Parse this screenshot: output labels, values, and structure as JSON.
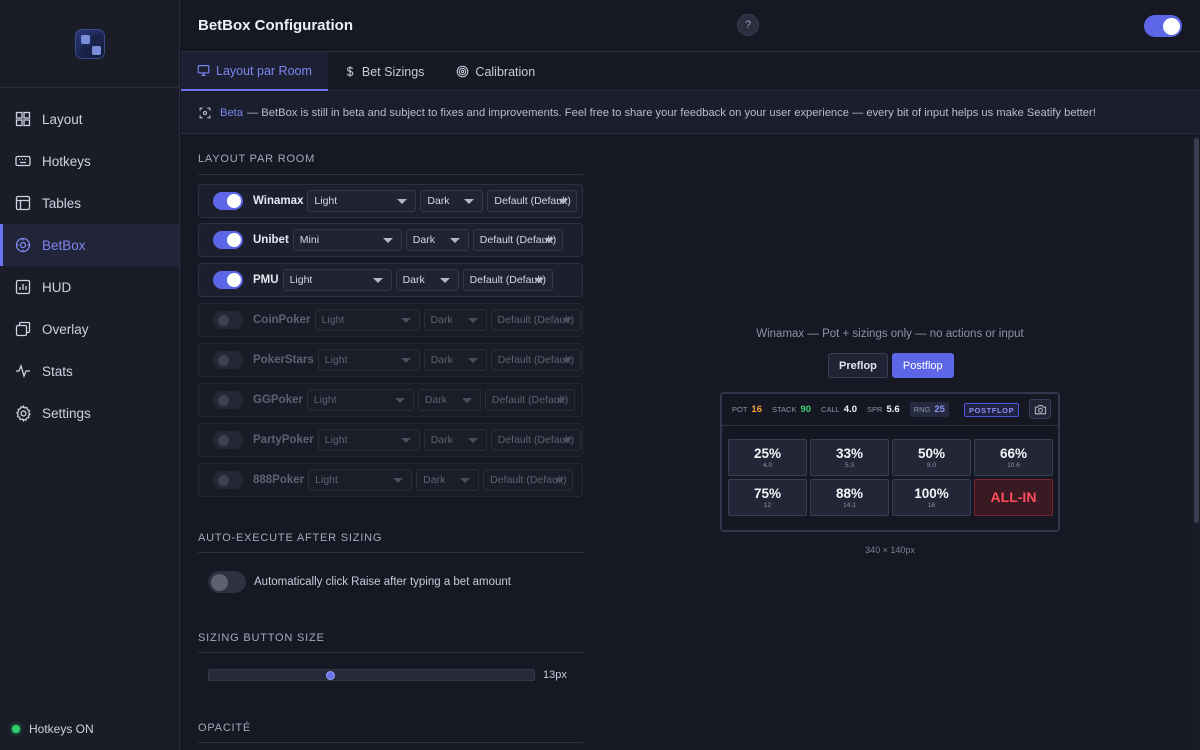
{
  "app": {
    "title": "BetBox Configuration",
    "help_label": "?",
    "master_enabled": true
  },
  "sidebar": {
    "items": [
      {
        "label": "Layout",
        "icon": "layout-grid-icon",
        "active": false
      },
      {
        "label": "Hotkeys",
        "icon": "keyboard-icon",
        "active": false
      },
      {
        "label": "Tables",
        "icon": "table-icon",
        "active": false
      },
      {
        "label": "BetBox",
        "icon": "chip-icon",
        "active": true
      },
      {
        "label": "HUD",
        "icon": "bar-chart-icon",
        "active": false
      },
      {
        "label": "Overlay",
        "icon": "overlay-icon",
        "active": false
      },
      {
        "label": "Stats",
        "icon": "activity-icon",
        "active": false
      },
      {
        "label": "Settings",
        "icon": "gear-icon",
        "active": false
      }
    ],
    "status": "Hotkeys ON"
  },
  "tabs": [
    {
      "label": "Layout par Room",
      "icon": "monitor-icon",
      "active": true
    },
    {
      "label": "Bet Sizings",
      "icon": "dollar-icon",
      "active": false
    },
    {
      "label": "Calibration",
      "icon": "target-icon",
      "active": false
    }
  ],
  "banner": {
    "beta": "Beta",
    "text": "— BetBox is still in beta and subject to fixes and improvements. Feel free to share your feedback on your user experience — every bit of input helps us make Seatify better!"
  },
  "layout_section": {
    "title": "LAYOUT PAR ROOM",
    "rooms": [
      {
        "name": "Winamax",
        "enabled": true,
        "size": "Light",
        "theme": "Dark",
        "preset": "Default (Default)"
      },
      {
        "name": "Unibet",
        "enabled": true,
        "size": "Mini",
        "theme": "Dark",
        "preset": "Default (Default)"
      },
      {
        "name": "PMU",
        "enabled": true,
        "size": "Light",
        "theme": "Dark",
        "preset": "Default (Default)"
      },
      {
        "name": "CoinPoker",
        "enabled": false,
        "size": "Light",
        "theme": "Dark",
        "preset": "Default (Default)"
      },
      {
        "name": "PokerStars",
        "enabled": false,
        "size": "Light",
        "theme": "Dark",
        "preset": "Default (Default)"
      },
      {
        "name": "GGPoker",
        "enabled": false,
        "size": "Light",
        "theme": "Dark",
        "preset": "Default (Default)"
      },
      {
        "name": "PartyPoker",
        "enabled": false,
        "size": "Light",
        "theme": "Dark",
        "preset": "Default (Default)"
      },
      {
        "name": "888Poker",
        "enabled": false,
        "size": "Light",
        "theme": "Dark",
        "preset": "Default (Default)"
      }
    ]
  },
  "auto_execute": {
    "title": "AUTO-EXECUTE AFTER SIZING",
    "label": "Automatically click Raise after typing a bet amount",
    "enabled": false
  },
  "sizing_button": {
    "title": "SIZING BUTTON SIZE",
    "value_label": "13px",
    "slider_fraction": 0.37
  },
  "opacity": {
    "title": "OPACITÉ"
  },
  "preview": {
    "caption": "Winamax — Pot + sizings only — no actions or input",
    "streets": [
      {
        "label": "Preflop",
        "active": false
      },
      {
        "label": "Postflop",
        "active": true
      }
    ],
    "stats": [
      {
        "label": "POT",
        "value": "16",
        "color": "orange"
      },
      {
        "label": "STACK",
        "value": "90",
        "color": "green"
      },
      {
        "label": "CALL",
        "value": "4.0",
        "color": "white"
      },
      {
        "label": "SPR",
        "value": "5.6",
        "color": "white"
      },
      {
        "label": "RNG",
        "value": "25",
        "color": "purple"
      }
    ],
    "street_tag": "POSTFLOP",
    "sizings": [
      {
        "pct": "25%",
        "amount": "4.0"
      },
      {
        "pct": "33%",
        "amount": "5.3"
      },
      {
        "pct": "50%",
        "amount": "8.0"
      },
      {
        "pct": "66%",
        "amount": "10.6"
      },
      {
        "pct": "75%",
        "amount": "12"
      },
      {
        "pct": "88%",
        "amount": "14.1"
      },
      {
        "pct": "100%",
        "amount": "16"
      },
      {
        "pct": "ALL-IN",
        "amount": ""
      }
    ],
    "dimensions": "340 × 140px"
  },
  "colors": {
    "accent": "#5c66e6",
    "background": "#161824",
    "status_on": "#2fcf6a",
    "allin": "#ff4d5e"
  }
}
